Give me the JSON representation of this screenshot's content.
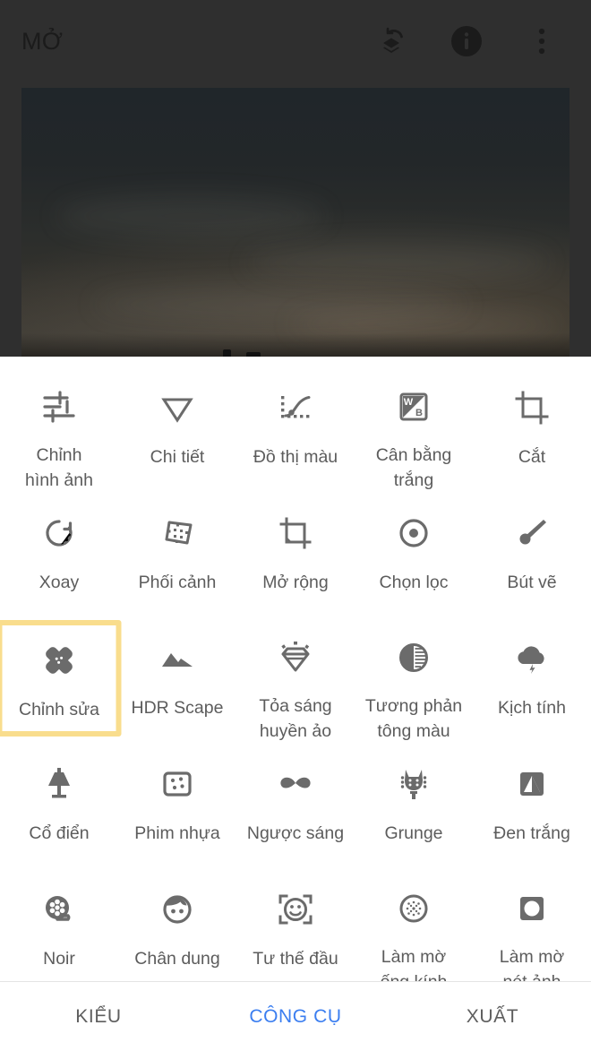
{
  "app": {
    "title": "MỞ",
    "accent_color": "#3b7ef0",
    "highlight_color": "#f9dd8d",
    "topbar_bg": "#2f2f2f",
    "panel_bg": "#ffffff",
    "icon_color": "#6b6b6b"
  },
  "topbar": {
    "title": "MỞ",
    "actions": [
      {
        "name": "stacks-undo-icon",
        "label": "Lịch sử chỉnh sửa"
      },
      {
        "name": "info-circle-icon",
        "label": "Thông tin"
      },
      {
        "name": "overflow-menu-icon",
        "label": "Tùy chọn khác"
      }
    ]
  },
  "photo": {
    "alt": "Ảnh bầu trời tối"
  },
  "tools": [
    {
      "label": "Chỉnh\nhình ảnh",
      "icon": "tune-sliders-icon",
      "selected": false
    },
    {
      "label": "Chi tiết",
      "icon": "details-triangle-icon",
      "selected": false
    },
    {
      "label": "Đồ thị màu",
      "icon": "curves-icon",
      "selected": false
    },
    {
      "label": "Cân bằng\ntrắng",
      "icon": "white-balance-icon",
      "selected": false
    },
    {
      "label": "Cắt",
      "icon": "crop-icon",
      "selected": false
    },
    {
      "label": "Xoay",
      "icon": "rotate-icon",
      "selected": false
    },
    {
      "label": "Phối cảnh",
      "icon": "perspective-icon",
      "selected": false
    },
    {
      "label": "Mở rộng",
      "icon": "expand-icon",
      "selected": false
    },
    {
      "label": "Chọn lọc",
      "icon": "selective-icon",
      "selected": false
    },
    {
      "label": "Bút vẽ",
      "icon": "brush-icon",
      "selected": false
    },
    {
      "label": "Chỉnh sửa",
      "icon": "healing-icon",
      "selected": true
    },
    {
      "label": "HDR Scape",
      "icon": "hdr-mountains-icon",
      "selected": false
    },
    {
      "label": "Tỏa sáng\nhuyền ảo",
      "icon": "glamour-glow-icon",
      "selected": false
    },
    {
      "label": "Tương phản\ntông màu",
      "icon": "tonal-contrast-icon",
      "selected": false
    },
    {
      "label": "Kịch tính",
      "icon": "drama-cloud-icon",
      "selected": false
    },
    {
      "label": "Cổ điển",
      "icon": "vintage-lamp-icon",
      "selected": false
    },
    {
      "label": "Phim nhựa",
      "icon": "grainy-film-icon",
      "selected": false
    },
    {
      "label": "Ngược sáng",
      "icon": "retrolux-mustache-icon",
      "selected": false
    },
    {
      "label": "Grunge",
      "icon": "grunge-guitar-icon",
      "selected": false
    },
    {
      "label": "Đen trắng",
      "icon": "black-white-icon",
      "selected": false
    },
    {
      "label": "Noir",
      "icon": "noir-film-reel-icon",
      "selected": false
    },
    {
      "label": "Chân dung",
      "icon": "portrait-face-icon",
      "selected": false
    },
    {
      "label": "Tư thế đầu",
      "icon": "head-pose-icon",
      "selected": false
    },
    {
      "label": "Làm mờ\nống kính",
      "icon": "lens-blur-icon",
      "selected": false
    },
    {
      "label": "Làm mờ\nnét ảnh",
      "icon": "vignette-icon",
      "selected": false
    }
  ],
  "tabs": [
    {
      "label": "KIỂU",
      "active": false
    },
    {
      "label": "CÔNG CỤ",
      "active": true
    },
    {
      "label": "XUẤT",
      "active": false
    }
  ]
}
